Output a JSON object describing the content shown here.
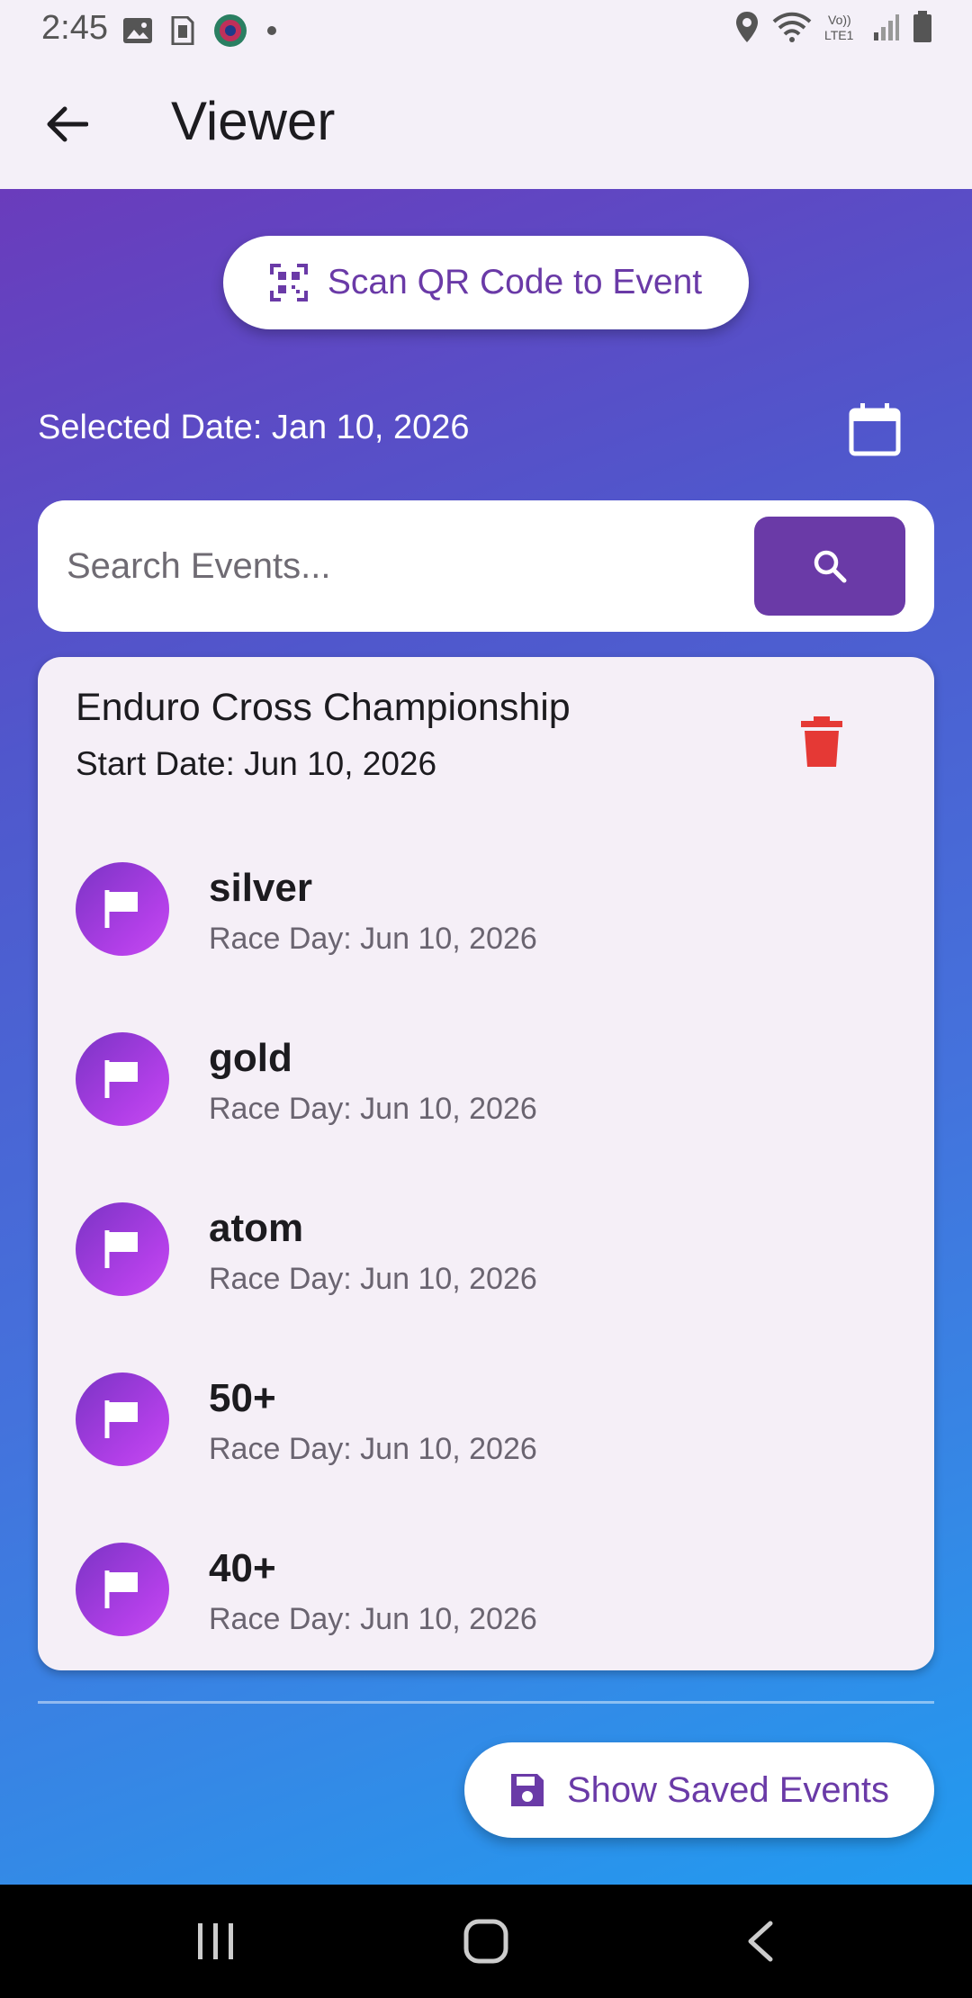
{
  "status_bar": {
    "time": "2:45"
  },
  "app_bar": {
    "title": "Viewer"
  },
  "scan_button": {
    "label": "Scan QR Code to Event"
  },
  "date_selector": {
    "text": "Selected Date: Jan 10, 2026"
  },
  "search": {
    "placeholder": "Search Events...",
    "value": ""
  },
  "event": {
    "title": "Enduro Cross Championship",
    "start_date": "Start Date: Jun 10, 2026",
    "races": [
      {
        "name": "silver",
        "day": "Race Day: Jun 10, 2026"
      },
      {
        "name": "gold",
        "day": "Race Day: Jun 10, 2026"
      },
      {
        "name": "atom",
        "day": "Race Day: Jun 10, 2026"
      },
      {
        "name": "50+",
        "day": "Race Day: Jun 10, 2026"
      },
      {
        "name": "40+",
        "day": "Race Day: Jun 10, 2026"
      }
    ]
  },
  "saved_button": {
    "label": "Show Saved Events"
  },
  "colors": {
    "accent": "#6a3aa7",
    "delete": "#e53935",
    "gradient_start": "#6a3cbc",
    "gradient_end": "#219bf0"
  },
  "icons": {
    "back": "arrow-left-icon",
    "scan": "qr-code-icon",
    "calendar": "calendar-icon",
    "search": "search-icon",
    "delete": "trash-icon",
    "race": "flag-icon",
    "save": "floppy-disk-icon"
  }
}
